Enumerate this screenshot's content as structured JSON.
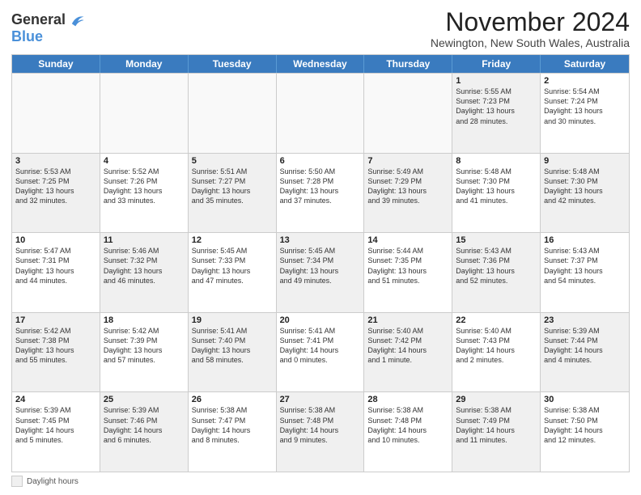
{
  "header": {
    "logo_line1": "General",
    "logo_line2": "Blue",
    "month_title": "November 2024",
    "location": "Newington, New South Wales, Australia"
  },
  "days_of_week": [
    "Sunday",
    "Monday",
    "Tuesday",
    "Wednesday",
    "Thursday",
    "Friday",
    "Saturday"
  ],
  "legend": {
    "box_label": "Daylight hours"
  },
  "weeks": [
    {
      "days": [
        {
          "num": "",
          "info": "",
          "empty": true
        },
        {
          "num": "",
          "info": "",
          "empty": true
        },
        {
          "num": "",
          "info": "",
          "empty": true
        },
        {
          "num": "",
          "info": "",
          "empty": true
        },
        {
          "num": "",
          "info": "",
          "empty": true
        },
        {
          "num": "1",
          "info": "Sunrise: 5:55 AM\nSunset: 7:23 PM\nDaylight: 13 hours\nand 28 minutes.",
          "shaded": true
        },
        {
          "num": "2",
          "info": "Sunrise: 5:54 AM\nSunset: 7:24 PM\nDaylight: 13 hours\nand 30 minutes.",
          "shaded": false
        }
      ]
    },
    {
      "days": [
        {
          "num": "3",
          "info": "Sunrise: 5:53 AM\nSunset: 7:25 PM\nDaylight: 13 hours\nand 32 minutes.",
          "shaded": true
        },
        {
          "num": "4",
          "info": "Sunrise: 5:52 AM\nSunset: 7:26 PM\nDaylight: 13 hours\nand 33 minutes.",
          "shaded": false
        },
        {
          "num": "5",
          "info": "Sunrise: 5:51 AM\nSunset: 7:27 PM\nDaylight: 13 hours\nand 35 minutes.",
          "shaded": true
        },
        {
          "num": "6",
          "info": "Sunrise: 5:50 AM\nSunset: 7:28 PM\nDaylight: 13 hours\nand 37 minutes.",
          "shaded": false
        },
        {
          "num": "7",
          "info": "Sunrise: 5:49 AM\nSunset: 7:29 PM\nDaylight: 13 hours\nand 39 minutes.",
          "shaded": true
        },
        {
          "num": "8",
          "info": "Sunrise: 5:48 AM\nSunset: 7:30 PM\nDaylight: 13 hours\nand 41 minutes.",
          "shaded": false
        },
        {
          "num": "9",
          "info": "Sunrise: 5:48 AM\nSunset: 7:30 PM\nDaylight: 13 hours\nand 42 minutes.",
          "shaded": true
        }
      ]
    },
    {
      "days": [
        {
          "num": "10",
          "info": "Sunrise: 5:47 AM\nSunset: 7:31 PM\nDaylight: 13 hours\nand 44 minutes.",
          "shaded": false
        },
        {
          "num": "11",
          "info": "Sunrise: 5:46 AM\nSunset: 7:32 PM\nDaylight: 13 hours\nand 46 minutes.",
          "shaded": true
        },
        {
          "num": "12",
          "info": "Sunrise: 5:45 AM\nSunset: 7:33 PM\nDaylight: 13 hours\nand 47 minutes.",
          "shaded": false
        },
        {
          "num": "13",
          "info": "Sunrise: 5:45 AM\nSunset: 7:34 PM\nDaylight: 13 hours\nand 49 minutes.",
          "shaded": true
        },
        {
          "num": "14",
          "info": "Sunrise: 5:44 AM\nSunset: 7:35 PM\nDaylight: 13 hours\nand 51 minutes.",
          "shaded": false
        },
        {
          "num": "15",
          "info": "Sunrise: 5:43 AM\nSunset: 7:36 PM\nDaylight: 13 hours\nand 52 minutes.",
          "shaded": true
        },
        {
          "num": "16",
          "info": "Sunrise: 5:43 AM\nSunset: 7:37 PM\nDaylight: 13 hours\nand 54 minutes.",
          "shaded": false
        }
      ]
    },
    {
      "days": [
        {
          "num": "17",
          "info": "Sunrise: 5:42 AM\nSunset: 7:38 PM\nDaylight: 13 hours\nand 55 minutes.",
          "shaded": true
        },
        {
          "num": "18",
          "info": "Sunrise: 5:42 AM\nSunset: 7:39 PM\nDaylight: 13 hours\nand 57 minutes.",
          "shaded": false
        },
        {
          "num": "19",
          "info": "Sunrise: 5:41 AM\nSunset: 7:40 PM\nDaylight: 13 hours\nand 58 minutes.",
          "shaded": true
        },
        {
          "num": "20",
          "info": "Sunrise: 5:41 AM\nSunset: 7:41 PM\nDaylight: 14 hours\nand 0 minutes.",
          "shaded": false
        },
        {
          "num": "21",
          "info": "Sunrise: 5:40 AM\nSunset: 7:42 PM\nDaylight: 14 hours\nand 1 minute.",
          "shaded": true
        },
        {
          "num": "22",
          "info": "Sunrise: 5:40 AM\nSunset: 7:43 PM\nDaylight: 14 hours\nand 2 minutes.",
          "shaded": false
        },
        {
          "num": "23",
          "info": "Sunrise: 5:39 AM\nSunset: 7:44 PM\nDaylight: 14 hours\nand 4 minutes.",
          "shaded": true
        }
      ]
    },
    {
      "days": [
        {
          "num": "24",
          "info": "Sunrise: 5:39 AM\nSunset: 7:45 PM\nDaylight: 14 hours\nand 5 minutes.",
          "shaded": false
        },
        {
          "num": "25",
          "info": "Sunrise: 5:39 AM\nSunset: 7:46 PM\nDaylight: 14 hours\nand 6 minutes.",
          "shaded": true
        },
        {
          "num": "26",
          "info": "Sunrise: 5:38 AM\nSunset: 7:47 PM\nDaylight: 14 hours\nand 8 minutes.",
          "shaded": false
        },
        {
          "num": "27",
          "info": "Sunrise: 5:38 AM\nSunset: 7:48 PM\nDaylight: 14 hours\nand 9 minutes.",
          "shaded": true
        },
        {
          "num": "28",
          "info": "Sunrise: 5:38 AM\nSunset: 7:48 PM\nDaylight: 14 hours\nand 10 minutes.",
          "shaded": false
        },
        {
          "num": "29",
          "info": "Sunrise: 5:38 AM\nSunset: 7:49 PM\nDaylight: 14 hours\nand 11 minutes.",
          "shaded": true
        },
        {
          "num": "30",
          "info": "Sunrise: 5:38 AM\nSunset: 7:50 PM\nDaylight: 14 hours\nand 12 minutes.",
          "shaded": false
        }
      ]
    }
  ]
}
